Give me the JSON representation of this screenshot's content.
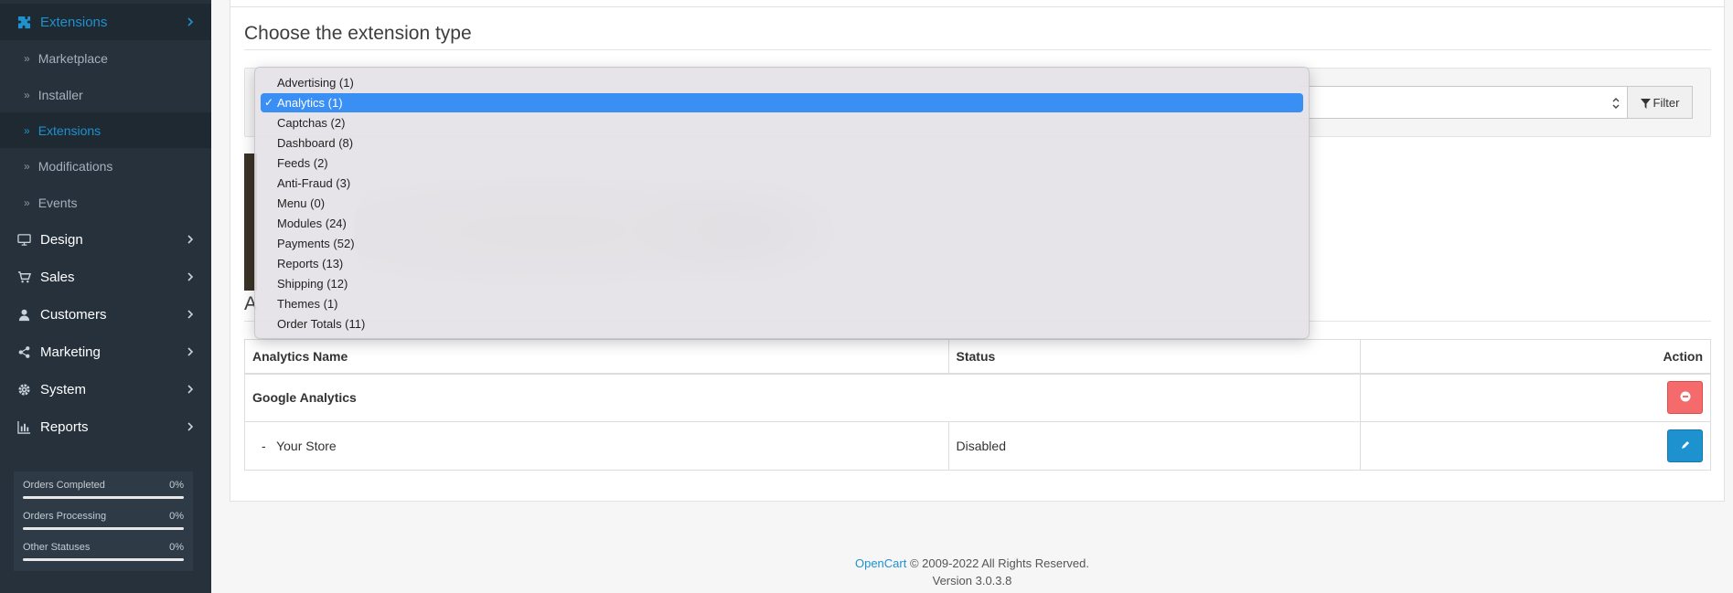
{
  "sidebar": {
    "extensions_label": "Extensions",
    "sub_items": [
      {
        "label": "Marketplace"
      },
      {
        "label": "Installer"
      },
      {
        "label": "Extensions"
      },
      {
        "label": "Modifications"
      },
      {
        "label": "Events"
      }
    ],
    "top_items": [
      {
        "label": "Design",
        "icon": "monitor-icon"
      },
      {
        "label": "Sales",
        "icon": "cart-icon"
      },
      {
        "label": "Customers",
        "icon": "user-icon"
      },
      {
        "label": "Marketing",
        "icon": "share-icon"
      },
      {
        "label": "System",
        "icon": "gear-icon"
      },
      {
        "label": "Reports",
        "icon": "bar-chart-icon"
      }
    ],
    "progress": [
      {
        "label": "Orders Completed",
        "percent_text": "0%",
        "value": 0
      },
      {
        "label": "Orders Processing",
        "percent_text": "0%",
        "value": 0
      },
      {
        "label": "Other Statuses",
        "percent_text": "0%",
        "value": 0
      }
    ]
  },
  "main": {
    "title": "Choose the extension type",
    "filter_button_label": "Filter",
    "section_heading_partial": "A",
    "dropdown": {
      "selected_index": 1,
      "options": [
        "Advertising (1)",
        "Analytics (1)",
        "Captchas (2)",
        "Dashboard (8)",
        "Feeds (2)",
        "Anti-Fraud (3)",
        "Menu (0)",
        "Modules (24)",
        "Payments (52)",
        "Reports (13)",
        "Shipping (12)",
        "Themes (1)",
        "Order Totals (11)"
      ]
    },
    "table": {
      "headers": [
        "Analytics Name",
        "Status",
        "Action"
      ],
      "group_row": {
        "name": "Google Analytics"
      },
      "store_row": {
        "name": "-   Your Store",
        "status": "Disabled"
      }
    }
  },
  "footer": {
    "link_text": "OpenCart",
    "copyright": " © 2009-2022 All Rights Reserved.",
    "version": "Version 3.0.3.8"
  },
  "colors": {
    "sidebar_bg": "#26313c",
    "accent": "#1e91cf",
    "danger": "#f56b6b",
    "selected_option": "#3a8ff5"
  }
}
